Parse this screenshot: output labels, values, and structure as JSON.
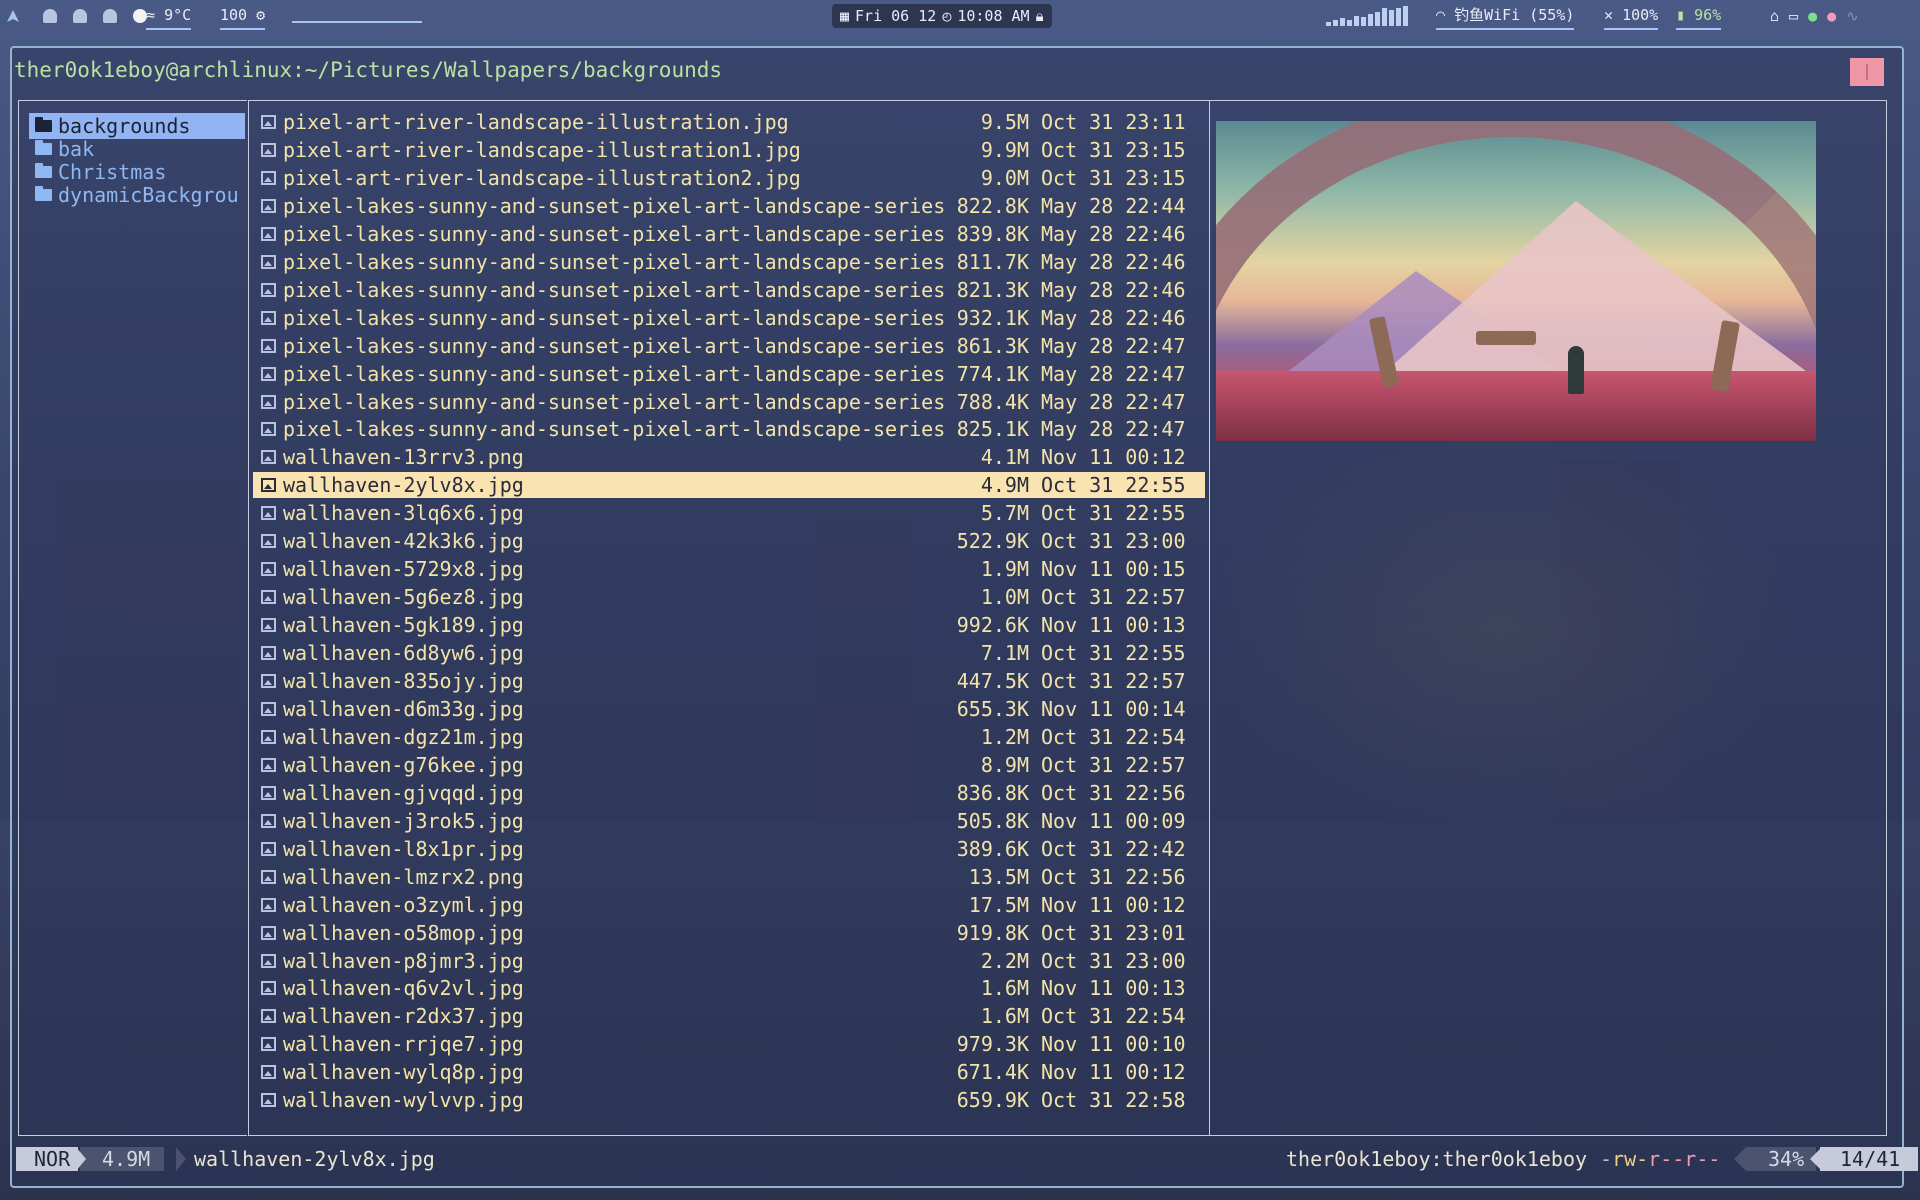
{
  "topbar": {
    "launcher_icon": "arch-icon",
    "weather": "9°C",
    "volume_level": "100",
    "datetime": {
      "date": "Fri 06 12",
      "time": "10:08 AM"
    },
    "wifi": "钓鱼WiFi (55%)",
    "sound": "100%",
    "battery": "96%"
  },
  "window": {
    "path": "ther0ok1eboy@archlinux:~/Pictures/Wallpapers/backgrounds"
  },
  "dirs": [
    {
      "name": "backgrounds",
      "selected": true
    },
    {
      "name": "bak",
      "selected": false
    },
    {
      "name": "Christmas",
      "selected": false
    },
    {
      "name": "dynamicBackgrou",
      "selected": false
    }
  ],
  "files": [
    {
      "name": "pixel-art-river-landscape-illustration.jpg",
      "size": "9.5M",
      "date": "Oct 31 23:11"
    },
    {
      "name": "pixel-art-river-landscape-illustration1.jpg",
      "size": "9.9M",
      "date": "Oct 31 23:15"
    },
    {
      "name": "pixel-art-river-landscape-illustration2.jpg",
      "size": "9.0M",
      "date": "Oct 31 23:15"
    },
    {
      "name": "pixel-lakes-sunny-and-sunset-pixel-art-landscape-series",
      "size": "822.8K",
      "date": "May 28 22:44"
    },
    {
      "name": "pixel-lakes-sunny-and-sunset-pixel-art-landscape-series",
      "size": "839.8K",
      "date": "May 28 22:46"
    },
    {
      "name": "pixel-lakes-sunny-and-sunset-pixel-art-landscape-series",
      "size": "811.7K",
      "date": "May 28 22:46"
    },
    {
      "name": "pixel-lakes-sunny-and-sunset-pixel-art-landscape-series",
      "size": "821.3K",
      "date": "May 28 22:46"
    },
    {
      "name": "pixel-lakes-sunny-and-sunset-pixel-art-landscape-series",
      "size": "932.1K",
      "date": "May 28 22:46"
    },
    {
      "name": "pixel-lakes-sunny-and-sunset-pixel-art-landscape-series",
      "size": "861.3K",
      "date": "May 28 22:47"
    },
    {
      "name": "pixel-lakes-sunny-and-sunset-pixel-art-landscape-series",
      "size": "774.1K",
      "date": "May 28 22:47"
    },
    {
      "name": "pixel-lakes-sunny-and-sunset-pixel-art-landscape-series",
      "size": "788.4K",
      "date": "May 28 22:47"
    },
    {
      "name": "pixel-lakes-sunny-and-sunset-pixel-art-landscape-series",
      "size": "825.1K",
      "date": "May 28 22:47"
    },
    {
      "name": "wallhaven-13rrv3.png",
      "size": "4.1M",
      "date": "Nov 11 00:12"
    },
    {
      "name": "wallhaven-2ylv8x.jpg",
      "size": "4.9M",
      "date": "Oct 31 22:55",
      "selected": true
    },
    {
      "name": "wallhaven-3lq6x6.jpg",
      "size": "5.7M",
      "date": "Oct 31 22:55"
    },
    {
      "name": "wallhaven-42k3k6.jpg",
      "size": "522.9K",
      "date": "Oct 31 23:00"
    },
    {
      "name": "wallhaven-5729x8.jpg",
      "size": "1.9M",
      "date": "Nov 11 00:15"
    },
    {
      "name": "wallhaven-5g6ez8.jpg",
      "size": "1.0M",
      "date": "Oct 31 22:57"
    },
    {
      "name": "wallhaven-5gk189.jpg",
      "size": "992.6K",
      "date": "Nov 11 00:13"
    },
    {
      "name": "wallhaven-6d8yw6.jpg",
      "size": "7.1M",
      "date": "Oct 31 22:55"
    },
    {
      "name": "wallhaven-835ojy.jpg",
      "size": "447.5K",
      "date": "Oct 31 22:57"
    },
    {
      "name": "wallhaven-d6m33g.jpg",
      "size": "655.3K",
      "date": "Nov 11 00:14"
    },
    {
      "name": "wallhaven-dgz21m.jpg",
      "size": "1.2M",
      "date": "Oct 31 22:54"
    },
    {
      "name": "wallhaven-g76kee.jpg",
      "size": "8.9M",
      "date": "Oct 31 22:57"
    },
    {
      "name": "wallhaven-gjvqqd.jpg",
      "size": "836.8K",
      "date": "Oct 31 22:56"
    },
    {
      "name": "wallhaven-j3rok5.jpg",
      "size": "505.8K",
      "date": "Nov 11 00:09"
    },
    {
      "name": "wallhaven-l8x1pr.jpg",
      "size": "389.6K",
      "date": "Oct 31 22:42"
    },
    {
      "name": "wallhaven-lmzrx2.png",
      "size": "13.5M",
      "date": "Oct 31 22:56"
    },
    {
      "name": "wallhaven-o3zyml.jpg",
      "size": "17.5M",
      "date": "Nov 11 00:12"
    },
    {
      "name": "wallhaven-o58mop.jpg",
      "size": "919.8K",
      "date": "Oct 31 23:01"
    },
    {
      "name": "wallhaven-p8jmr3.jpg",
      "size": "2.2M",
      "date": "Oct 31 23:00"
    },
    {
      "name": "wallhaven-q6v2vl.jpg",
      "size": "1.6M",
      "date": "Nov 11 00:13"
    },
    {
      "name": "wallhaven-r2dx37.jpg",
      "size": "1.6M",
      "date": "Oct 31 22:54"
    },
    {
      "name": "wallhaven-rrjqe7.jpg",
      "size": "979.3K",
      "date": "Nov 11 00:10"
    },
    {
      "name": "wallhaven-wylq8p.jpg",
      "size": "671.4K",
      "date": "Nov 11 00:12"
    },
    {
      "name": "wallhaven-wylvvp.jpg",
      "size": "659.9K",
      "date": "Oct 31 22:58"
    }
  ],
  "status": {
    "mode": "NOR",
    "size": "4.9M",
    "filename": "wallhaven-2ylv8x.jpg",
    "owner": "ther0ok1eboy:ther0ok1eboy",
    "perm_type": "-",
    "perm_u": "rw-",
    "perm_g": "r--",
    "perm_o": "r--",
    "percent": "34%",
    "position": "14/41"
  },
  "colors": {
    "selection_bg": "#f9e3b1",
    "dir_selected_bg": "#93b4f2",
    "file_text": "#f2e3a9",
    "dir_text": "#8fb7f1",
    "path_text": "#b7e2a4"
  }
}
